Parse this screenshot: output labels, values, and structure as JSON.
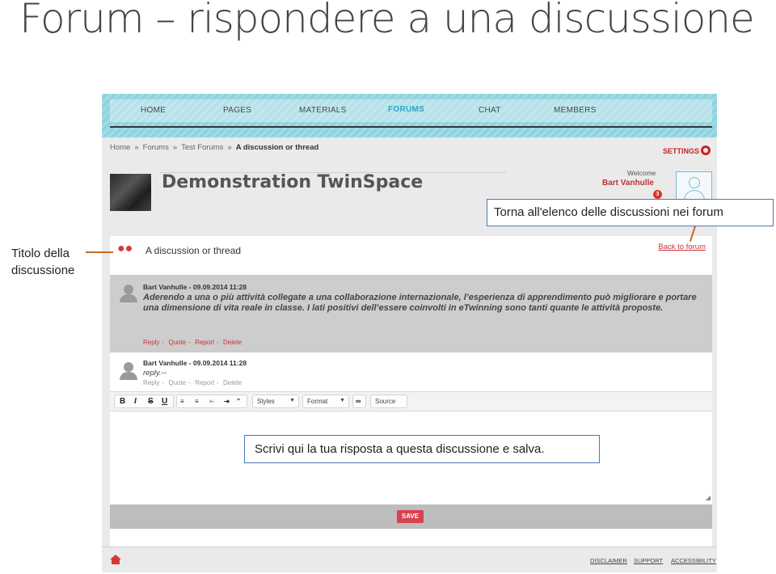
{
  "slide": {
    "title": "Forum – rispondere a una discussione"
  },
  "nav": {
    "items": [
      "HOME",
      "PAGES",
      "MATERIALS",
      "FORUMS",
      "CHAT",
      "MEMBERS"
    ]
  },
  "breadcrumb": {
    "home": "Home",
    "forums": "Forums",
    "test_forums": "Test Forums",
    "current": "A discussion or thread",
    "separator": "»"
  },
  "settings_label": "SETTINGS",
  "space": {
    "title": "Demonstration TwinSpace"
  },
  "user": {
    "welcome": "Welcome",
    "name": "Bart Vanhulle",
    "notifications": "3"
  },
  "thread": {
    "title": "A discussion or thread",
    "back_label": "Back to forum",
    "posts": [
      {
        "meta": "Bart Vanhulle - 09.09.2014 11:28",
        "text": "Aderendo a una o più attività collegate a una collaborazione internazionale, l’esperienza di apprendimento può migliorare e portare una dimensione di vita reale in classe. I lati positivi dell’essere coinvolti in eTwinning sono tanti quante le attività proposte."
      },
      {
        "meta": "Bart Vanhulle - 09.09.2014 11:28",
        "text": "reply.--"
      }
    ],
    "actions": {
      "reply": "Reply",
      "quote": "Quote",
      "report": "Report",
      "delete": "Delete",
      "sep": "-"
    }
  },
  "editor": {
    "bold": "B",
    "italic": "I",
    "strike": "S",
    "underline": "U",
    "styles": "Styles",
    "format": "Format",
    "source": "Source"
  },
  "save_label": "SAVE",
  "footer": {
    "disclaimer": "DISCLAIMER",
    "support": "SUPPORT",
    "accessibility": "ACCESSIBILITY"
  },
  "callouts": {
    "back": "Torna all'elenco delle discussioni nei forum",
    "title_line1": "Titolo della",
    "title_line2": "discussione",
    "reply": "Scrivi qui la tua risposta a questa discussione e salva."
  },
  "colors": {
    "accent": "#d23a3a",
    "nav": "#8fd3df",
    "active_nav": "#2aa7c4",
    "callout_border": "#4a78b8",
    "connector": "#c9691e"
  }
}
